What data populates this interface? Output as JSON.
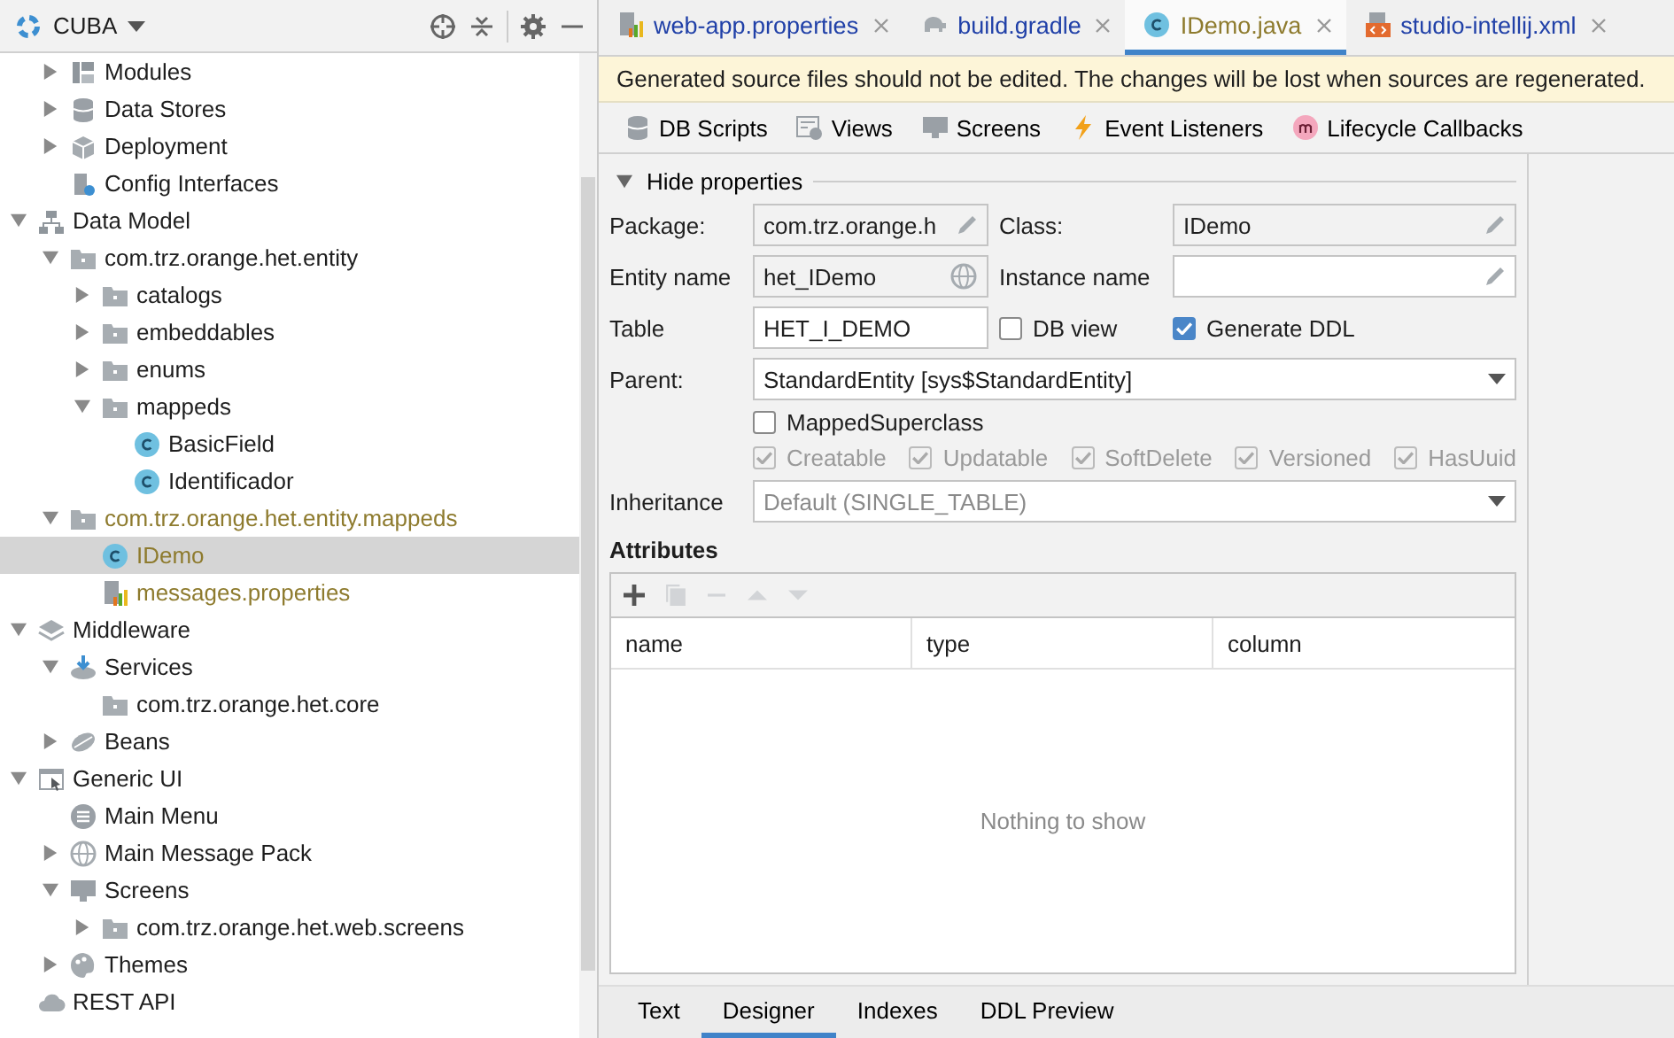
{
  "project_panel": {
    "title": "CUBA",
    "tree_continued": [
      {
        "label": "Modules",
        "kind": "modules",
        "expanded": false,
        "selected": false,
        "unversioned": false
      },
      {
        "label": "Data Stores",
        "kind": "datastore",
        "expanded": false,
        "selected": false,
        "unversioned": false
      },
      {
        "label": "Deployment",
        "kind": "deployment",
        "expanded": false,
        "selected": false,
        "unversioned": false
      },
      {
        "label": "Config Interfaces",
        "kind": "config",
        "selected": false,
        "unversioned": false
      }
    ],
    "tree": [
      {
        "label": "Data Model",
        "kind": "model",
        "expanded": true,
        "selected": false,
        "unversioned": false,
        "children": [
          {
            "label": "com.trz.orange.het.entity",
            "kind": "package",
            "expanded": true,
            "selected": false,
            "unversioned": false,
            "children": [
              {
                "label": "catalogs",
                "kind": "package",
                "expanded": false,
                "selected": false,
                "unversioned": false
              },
              {
                "label": "embeddables",
                "kind": "package",
                "expanded": false,
                "selected": false,
                "unversioned": false
              },
              {
                "label": "enums",
                "kind": "package",
                "expanded": false,
                "selected": false,
                "unversioned": false
              },
              {
                "label": "mappeds",
                "kind": "package",
                "expanded": true,
                "selected": false,
                "unversioned": false,
                "children": [
                  {
                    "label": "BasicField",
                    "kind": "class",
                    "selected": false,
                    "unversioned": false
                  },
                  {
                    "label": "Identificador",
                    "kind": "class",
                    "selected": false,
                    "unversioned": false
                  }
                ]
              }
            ]
          },
          {
            "label": "com.trz.orange.het.entity.mappeds",
            "kind": "package",
            "expanded": true,
            "selected": false,
            "unversioned": true,
            "children": [
              {
                "label": "IDemo",
                "kind": "class",
                "selected": true,
                "unversioned": true
              },
              {
                "label": "messages.properties",
                "kind": "properties",
                "selected": false,
                "unversioned": true
              }
            ]
          }
        ]
      },
      {
        "label": "Middleware",
        "kind": "middleware",
        "expanded": true,
        "selected": false,
        "unversioned": false,
        "children": [
          {
            "label": "Services",
            "kind": "services",
            "expanded": true,
            "selected": false,
            "unversioned": false,
            "children": [
              {
                "label": "com.trz.orange.het.core",
                "kind": "package",
                "selected": false,
                "unversioned": false
              }
            ]
          },
          {
            "label": "Beans",
            "kind": "beans",
            "expanded": false,
            "selected": false,
            "unversioned": false
          }
        ]
      },
      {
        "label": "Generic UI",
        "kind": "ui",
        "expanded": true,
        "selected": false,
        "unversioned": false,
        "children": [
          {
            "label": "Main Menu",
            "kind": "mainmenu",
            "selected": false,
            "unversioned": false
          },
          {
            "label": "Main Message Pack",
            "kind": "messages",
            "expanded": false,
            "selected": false,
            "unversioned": false
          },
          {
            "label": "Screens",
            "kind": "screens",
            "expanded": true,
            "selected": false,
            "unversioned": false,
            "children": [
              {
                "label": "com.trz.orange.het.web.screens",
                "kind": "package",
                "expanded": false,
                "selected": false,
                "unversioned": false
              }
            ]
          },
          {
            "label": "Themes",
            "kind": "themes",
            "expanded": false,
            "selected": false,
            "unversioned": false
          }
        ]
      },
      {
        "label": "REST API",
        "kind": "rest",
        "selected": false,
        "unversioned": false
      }
    ]
  },
  "editor_tabs": [
    {
      "label": "web-app.properties",
      "kind": "properties",
      "selected": false,
      "unversioned": false
    },
    {
      "label": "build.gradle",
      "kind": "gradle",
      "selected": false,
      "unversioned": false
    },
    {
      "label": "IDemo.java",
      "kind": "class",
      "selected": true,
      "unversioned": true
    },
    {
      "label": "studio-intellij.xml",
      "kind": "xml",
      "selected": false,
      "unversioned": false
    }
  ],
  "banner": "Generated source files should not be edited. The changes will be lost when sources are regenerated.",
  "toolbar": [
    {
      "label": "DB Scripts",
      "kind": "datastore"
    },
    {
      "label": "Views",
      "kind": "views"
    },
    {
      "label": "Screens",
      "kind": "screens"
    },
    {
      "label": "Event Listeners",
      "kind": "listeners"
    },
    {
      "label": "Lifecycle Callbacks",
      "kind": "callbacks"
    }
  ],
  "properties": {
    "toggle": {
      "label": "Hide properties",
      "expanded": true
    },
    "package": {
      "label": "Package:",
      "value": "com.trz.orange.h",
      "readonly": true
    },
    "class": {
      "label": "Class:",
      "value": "IDemo",
      "readonly": true
    },
    "entity_name": {
      "label": "Entity name",
      "value": "het_IDemo",
      "readonly": true
    },
    "instance_name": {
      "label": "Instance name",
      "readonly": false
    },
    "table": {
      "label": "Table",
      "value": "HET_I_DEMO",
      "readonly": false
    },
    "db_view": {
      "label": "DB view",
      "checked": false,
      "disabled": false
    },
    "generate_ddl": {
      "label": "Generate DDL",
      "checked": true,
      "disabled": false
    },
    "parent": {
      "label": "Parent:",
      "value": "StandardEntity [sys$StandardEntity]",
      "disabled": false
    },
    "mapped_superclass": {
      "label": "MappedSuperclass",
      "checked": false,
      "disabled": false
    },
    "traits": [
      {
        "label": "Creatable",
        "checked": true,
        "disabled": true
      },
      {
        "label": "Updatable",
        "checked": true,
        "disabled": true
      },
      {
        "label": "SoftDelete",
        "checked": true,
        "disabled": true
      },
      {
        "label": "Versioned",
        "checked": true,
        "disabled": true
      },
      {
        "label": "HasUuid",
        "checked": true,
        "disabled": true
      }
    ],
    "inheritance": {
      "label": "Inheritance",
      "value": "Default (SINGLE_TABLE)",
      "disabled": true
    }
  },
  "attributes": {
    "title": "Attributes",
    "tools": [
      {
        "kind": "add",
        "disabled": false
      },
      {
        "kind": "copy",
        "disabled": true
      },
      {
        "kind": "remove",
        "disabled": true
      },
      {
        "kind": "up",
        "disabled": true
      },
      {
        "kind": "down",
        "disabled": true
      }
    ],
    "columns": [
      "name",
      "type",
      "column"
    ],
    "empty_text": "Nothing to show"
  },
  "bottom_tabs": [
    {
      "label": "Text",
      "selected": false
    },
    {
      "label": "Designer",
      "selected": true
    },
    {
      "label": "Indexes",
      "selected": false
    },
    {
      "label": "DDL Preview",
      "selected": false
    }
  ]
}
